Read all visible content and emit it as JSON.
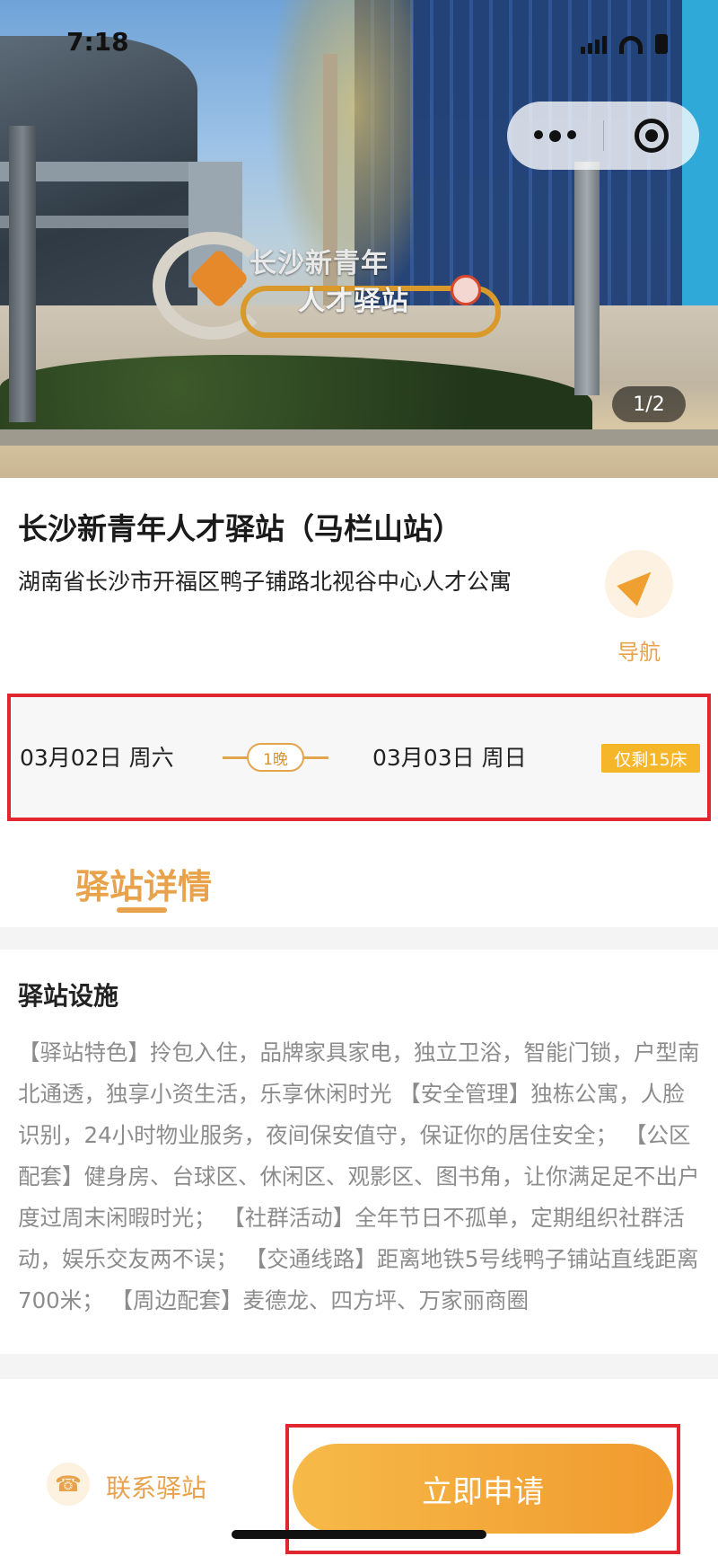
{
  "status_bar": {
    "time": "7:18"
  },
  "hero": {
    "sign_line1": "长沙新青年",
    "sign_line2": "人才驿站",
    "pager": "1/2"
  },
  "station": {
    "name": "长沙新青年人才驿站（马栏山站）",
    "address": "湖南省长沙市开福区鸭子铺路北视谷中心人才公寓",
    "nav_label": "导航"
  },
  "booking": {
    "checkin": "03月02日 周六",
    "nights": "1晚",
    "checkout": "03月03日 周日",
    "beds_left": "仅剩15床"
  },
  "tabs": {
    "detail": "驿站详情"
  },
  "facilities": {
    "title": "驿站设施",
    "description": "【驿站特色】拎包入住，品牌家具家电，独立卫浴，智能门锁，户型南北通透，独享小资生活，乐享休闲时光 【安全管理】独栋公寓，人脸识别，24小时物业服务，夜间保安值守，保证你的居住安全； 【公区配套】健身房、台球区、休闲区、观影区、图书角，让你满足足不出户度过周末闲暇时光； 【社群活动】全年节日不孤单，定期组织社群活动，娱乐交友两不误； 【交通线路】距离地铁5号线鸭子铺站直线距离700米； 【周边配套】麦德龙、四方坪、万家丽商圈"
  },
  "actions": {
    "contact": "联系驿站",
    "apply": "立即申请"
  },
  "icons": {
    "nav": "navigation-arrow-icon",
    "contact": "phone-icon",
    "more": "more-dots-icon",
    "close": "target-close-icon"
  },
  "colors": {
    "accent": "#e9a24c",
    "badge": "#f5b62a",
    "highlight": "#e0262f"
  }
}
